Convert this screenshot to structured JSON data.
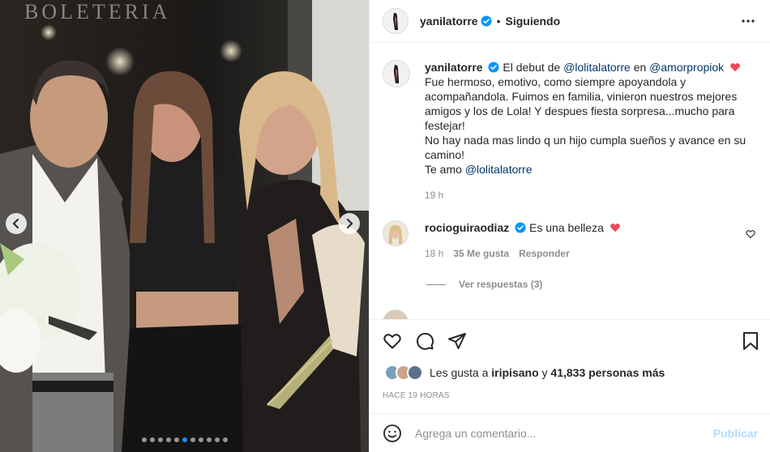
{
  "header": {
    "username": "yanilatorre",
    "separator": "•",
    "follow_label": "Siguiendo"
  },
  "caption": {
    "username": "yanilatorre",
    "intro": "El debut de",
    "mention1": "@lolitalatorre",
    "connector": "en",
    "mention2": "@amorpropiok",
    "body": "Fue hermoso, emotivo, como siempre apoyandola y acompañandola. Fuimos en familia, vinieron nuestros mejores amigos y los de Lola! Y despues fiesta sorpresa...mucho para festejar!",
    "body2": "No hay nada mas lindo q un hijo cumpla sueños y avance en su camino!",
    "closing": "Te amo",
    "mention3": "@lolitalatorre",
    "age": "19 h"
  },
  "comments": [
    {
      "username": "rocioguiraodiaz",
      "text": "Es una belleza",
      "age": "18 h",
      "likes": "35 Me gusta",
      "reply_label": "Responder",
      "replies_label": "Ver respuestas (3)"
    }
  ],
  "likes": {
    "prefix": "Les gusta a",
    "first_user": "iripisano",
    "connector": "y",
    "others": "41,833 personas más"
  },
  "timestamp": "HACE 19 HORAS",
  "add_comment": {
    "placeholder": "Agrega un comentario...",
    "publish_label": "Publicar"
  },
  "media": {
    "sign": "BOLETERIA",
    "slide_count": 11,
    "active_slide": 5
  },
  "colors": {
    "link": "#00376b",
    "verified": "#0095f6",
    "heart": "#ed4956",
    "publish_disabled": "#b3dbff",
    "secondary_text": "#8e8e8e"
  }
}
